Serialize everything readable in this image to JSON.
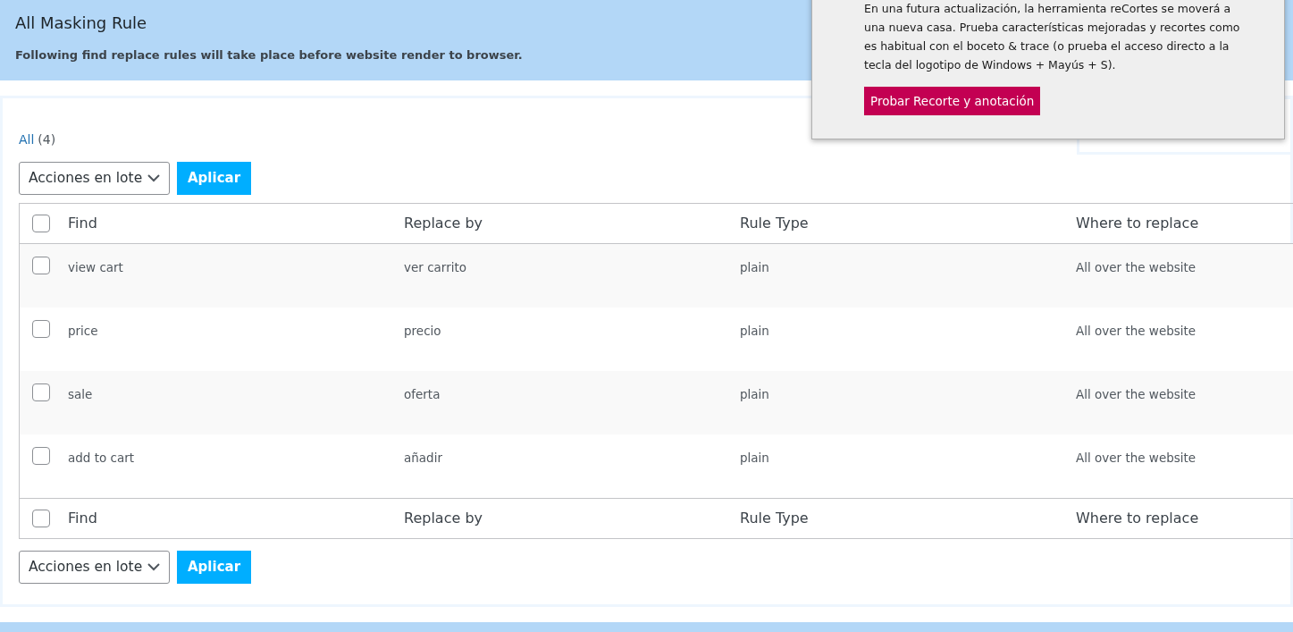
{
  "header": {
    "title": "All Masking Rule",
    "subtitle": "Following find replace rules will take place before website render to browser."
  },
  "filter": {
    "label": "All",
    "count": "(4)"
  },
  "bulk_top": {
    "select": "Acciones en lote",
    "button": "Aplicar"
  },
  "table": {
    "columns": [
      "Find",
      "Replace by",
      "Rule Type",
      "Where to replace"
    ],
    "header_checked": false,
    "rows": [
      {
        "checked": false,
        "cells": [
          "view cart",
          "ver carrito",
          "plain",
          "All over the website"
        ]
      },
      {
        "checked": false,
        "cells": [
          "price",
          "precio",
          "plain",
          "All over the website"
        ]
      },
      {
        "checked": false,
        "cells": [
          "sale",
          "oferta",
          "plain",
          "All over the website"
        ]
      },
      {
        "checked": false,
        "cells": [
          "add to cart",
          "añadir",
          "plain",
          "All over the website"
        ]
      }
    ],
    "footer_checked": false,
    "footer_columns": [
      "Find",
      "Replace by",
      "Rule Type",
      "Where to replace"
    ]
  },
  "bulk_bottom": {
    "select": "Acciones en lote",
    "button": "Aplicar"
  },
  "notification": {
    "text": "En una futura actualización, la herramienta reCortes se moverá a una nueva casa. Prueba características mejoradas y recortes como es habitual con el boceto & trace (o prueba el acceso directo a la tecla del logotipo de Windows + Mayús + S).",
    "button": "Probar Recorte y anotación"
  }
}
